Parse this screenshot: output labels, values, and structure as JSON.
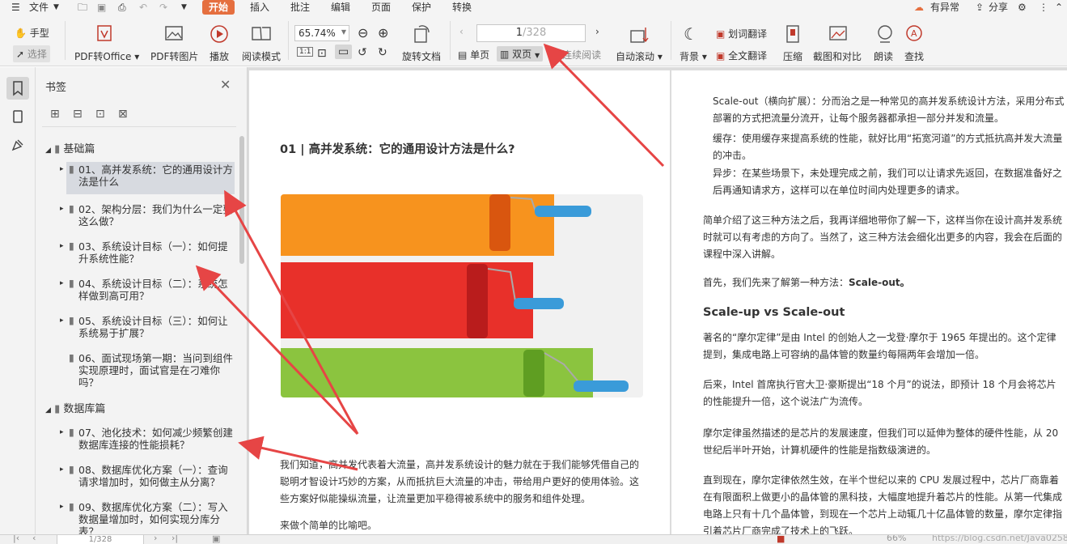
{
  "menubar": {
    "file": "文件",
    "tabs": [
      "开始",
      "插入",
      "批注",
      "编辑",
      "页面",
      "保护",
      "转换"
    ],
    "right": {
      "anomaly": "有异常",
      "share": "分享"
    }
  },
  "toolbar": {
    "hand": "手型",
    "select": "选择",
    "pdf_to_office": "PDF转Office",
    "pdf_to_image": "PDF转图片",
    "play": "播放",
    "read_mode": "阅读模式",
    "zoom": "65.74%",
    "page_current": "1",
    "page_total": "/328",
    "rotate_doc": "旋转文档",
    "single_page": "单页",
    "double_page": "双页",
    "continuous": "连续阅读",
    "auto_scroll": "自动滚动",
    "background": "背景",
    "word_translate": "划词翻译",
    "full_translate": "全文翻译",
    "compress": "压缩",
    "screenshot_compare": "截图和对比",
    "read_aloud": "朗读",
    "search": "查找"
  },
  "sidebar": {
    "title": "书签",
    "groups": [
      {
        "label": "基础篇",
        "items": [
          {
            "label": "01、高并发系统：它的通用设计方法是什么",
            "selected": true
          },
          {
            "label": "02、架构分层：我们为什么一定要这么做？"
          },
          {
            "label": "03、系统设计目标（一）：如何提升系统性能？"
          },
          {
            "label": "04、系统设计目标（二）：系统怎样做到高可用？"
          },
          {
            "label": "05、系统设计目标（三）：如何让系统易于扩展？"
          },
          {
            "label": "06、面试现场第一期：当问到组件实现原理时，面试官是在刁难你吗？"
          }
        ]
      },
      {
        "label": "数据库篇",
        "items": [
          {
            "label": "07、池化技术：如何减少频繁创建数据库连接的性能损耗？"
          },
          {
            "label": "08、数据库优化方案（一）：查询请求增加时，如何做主从分离？"
          },
          {
            "label": "09、数据库优化方案（二）：写入数据量增加时，如何实现分库分表？"
          }
        ]
      }
    ]
  },
  "left_page": {
    "title": "01 | 高并发系统：它的通用设计方法是什么?",
    "para1": "我们知道，高并发代表着大流量，高并发系统设计的魅力就在于我们能够凭借自己的聪明才智设计巧妙的方案，从而抵抗巨大流量的冲击，带给用户更好的使用体验。这些方案好似能操纵流量，让流量更加平稳得被系统中的服务和组件处理。",
    "para2": "来做个简单的比喻吧。"
  },
  "right_page": {
    "bullet1": "Scale-out（横向扩展）：分而治之是一种常见的高并发系统设计方法，采用分布式部署的方式把流量分流开，让每个服务器都承担一部分并发和流量。",
    "bullet2": "缓存：使用缓存来提高系统的性能，就好比用“拓宽河道”的方式抵抗高并发大流量的冲击。",
    "bullet3": "异步：在某些场景下，未处理完成之前，我们可以让请求先返回，在数据准备好之后再通知请求方，这样可以在单位时间内处理更多的请求。",
    "para1": "简单介绍了这三种方法之后，我再详细地带你了解一下，这样当你在设计高并发系统时就可以有考虑的方向了。当然了，这三种方法会细化出更多的内容，我会在后面的课程中深入讲解。",
    "para2_prefix": "首先，我们先来了解第一种方法：",
    "para2_bold": "Scale-out。",
    "heading": "Scale-up vs Scale-out",
    "para3": "著名的“摩尔定律”是由 Intel 的创始人之一戈登·摩尔于 1965 年提出的。这个定律提到，集成电路上可容纳的晶体管的数量约每隔两年会增加一倍。",
    "para4": "后来，Intel 首席执行官大卫·豪斯提出“18 个月”的说法，即预计 18 个月会将芯片的性能提升一倍，这个说法广为流传。",
    "para5": "摩尔定律虽然描述的是芯片的发展速度，但我们可以延伸为整体的硬件性能，从 20 世纪后半叶开始，计算机硬件的性能是指数级演进的。",
    "para6": "直到现在，摩尔定律依然生效，在半个世纪以来的 CPU 发展过程中，芯片厂商靠着在有限面积上做更小的晶体管的黑科技，大幅度地提升着芯片的性能。从第一代集成电路上只有十几个晶体管，到现在一个芯片上动辄几十亿晶体管的数量，摩尔定律指引着芯片厂商完成了技术上的飞跃。"
  },
  "statusbar": {
    "page": "1/328",
    "zoom": "66%",
    "watermark": "https://blog.csdn.net/Java0258"
  },
  "colors": {
    "accent": "#e56f3f",
    "arrow": "#e64545",
    "selected": "#d7dae0"
  }
}
